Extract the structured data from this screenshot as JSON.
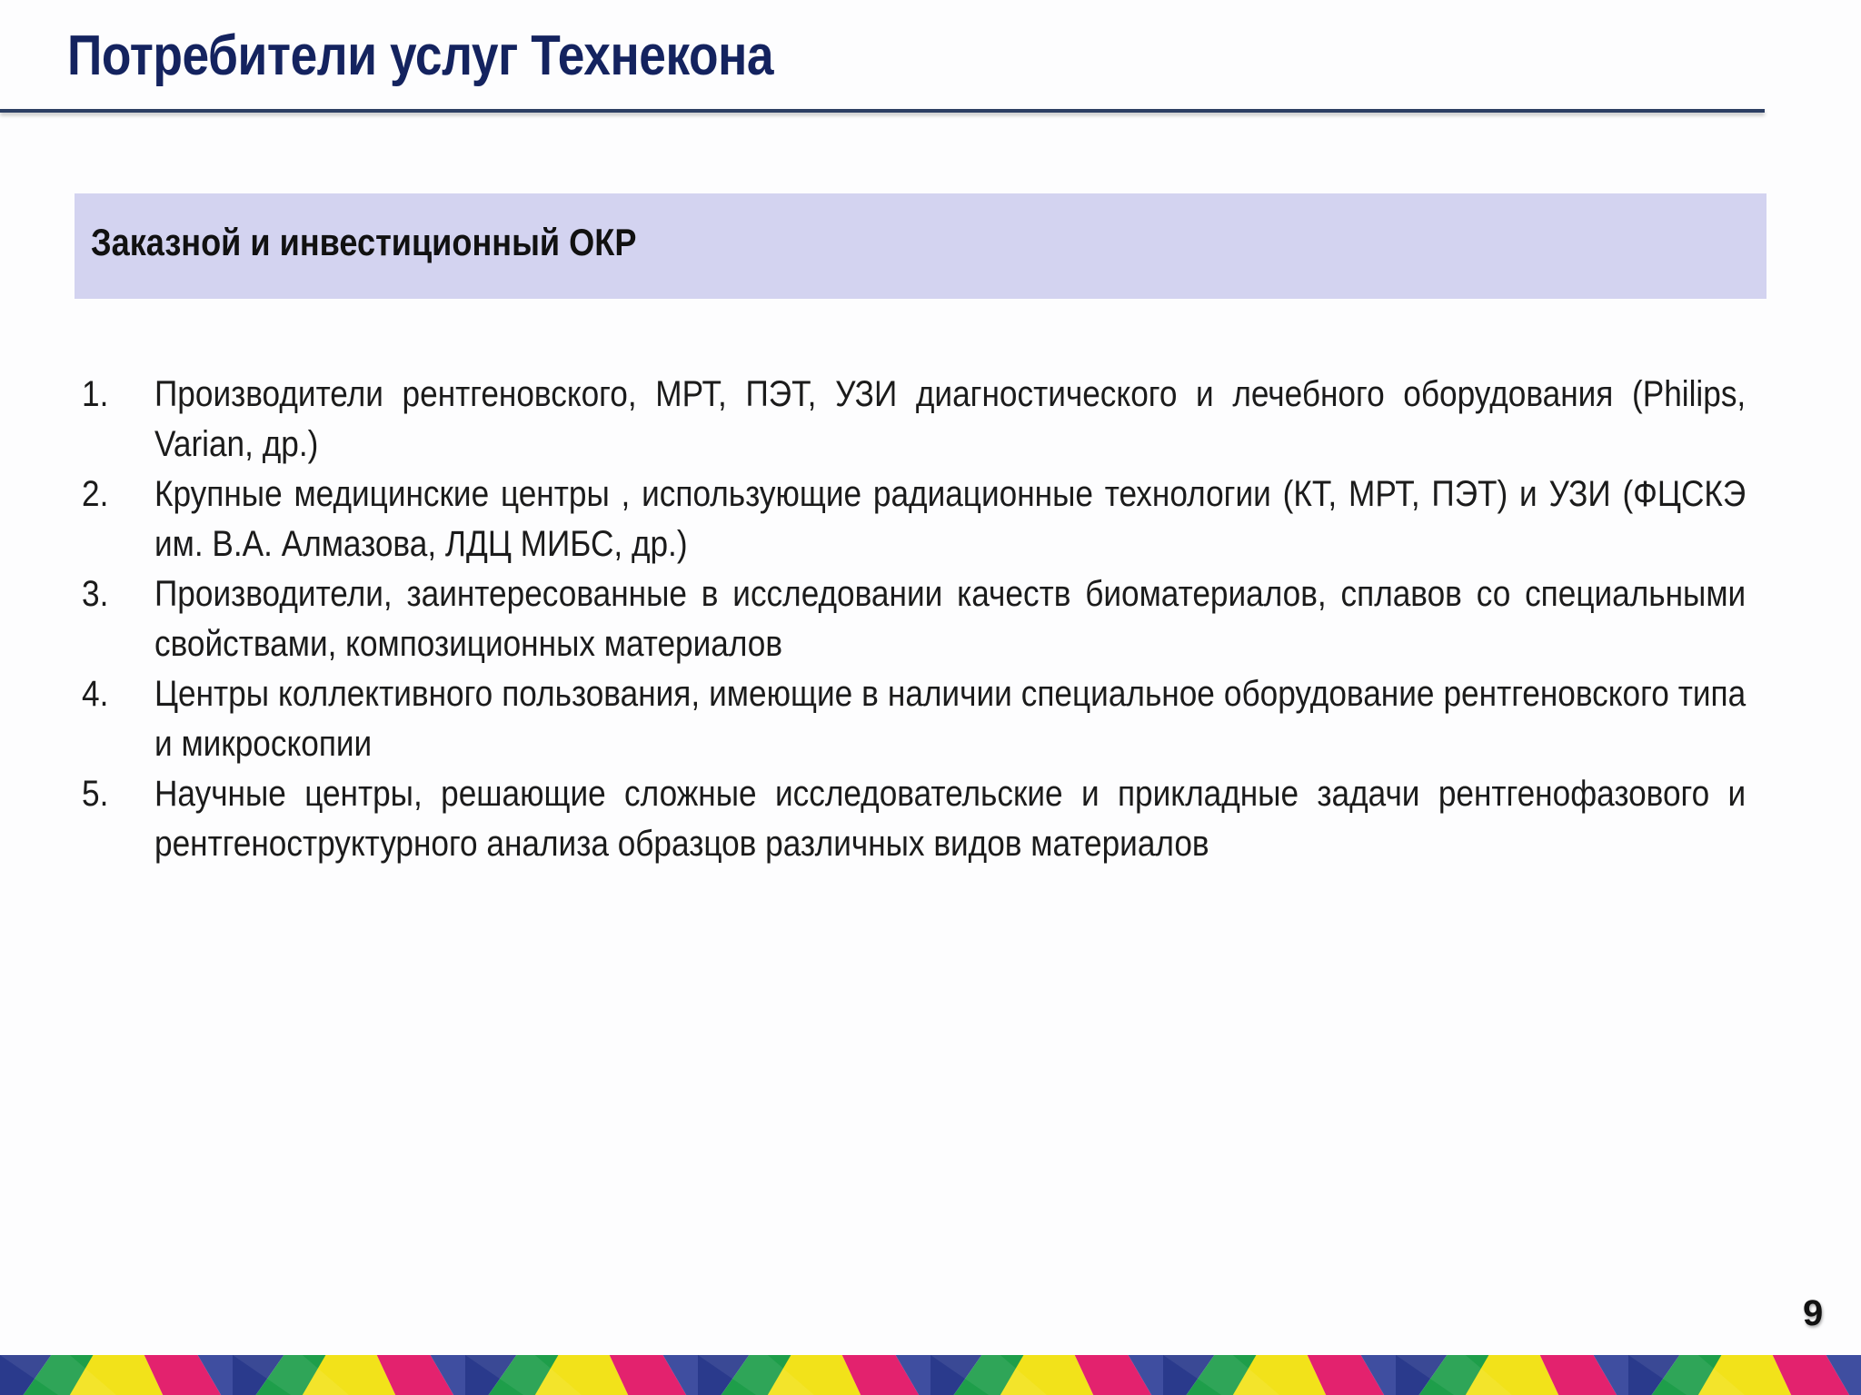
{
  "slide": {
    "title": "Потребители услуг Технекона",
    "section": "Заказной и инвестиционный ОКР",
    "items": [
      {
        "number": "1.",
        "text": "Производители рентгеновского, МРТ, ПЭТ, УЗИ диагностического и лечебного оборудования (Philips, Varian, др.)"
      },
      {
        "number": "2.",
        "text": "Крупные медицинские центры , использующие радиационные технологии (КТ, МРТ, ПЭТ) и УЗИ (ФЦСКЭ им. В.А. Алмазова, ЛДЦ МИБС, др.)"
      },
      {
        "number": "3.",
        "text": "Производители, заинтересованные в исследовании качеств биоматериалов, сплавов со специальными свойствами, композиционных материалов"
      },
      {
        "number": "4.",
        "text": "Центры коллективного пользования, имеющие в наличии специальное оборудование рентгеновского типа и микроскопии"
      },
      {
        "number": "5.",
        "text": "Научные центры, решающие сложные исследовательские и прикладные задачи рентгенофазового и рентгеноструктурного анализа образцов различных видов материалов"
      }
    ],
    "page_number": "9"
  },
  "colors": {
    "title": "#14235f",
    "rule": "#2c3e63",
    "section_band": "#d3d3f0",
    "body_text": "#1b1b1b",
    "footer": [
      "#2a3a8c",
      "#1e9e4a",
      "#f2e21a",
      "#e3226e",
      "#3f4ea0"
    ]
  }
}
